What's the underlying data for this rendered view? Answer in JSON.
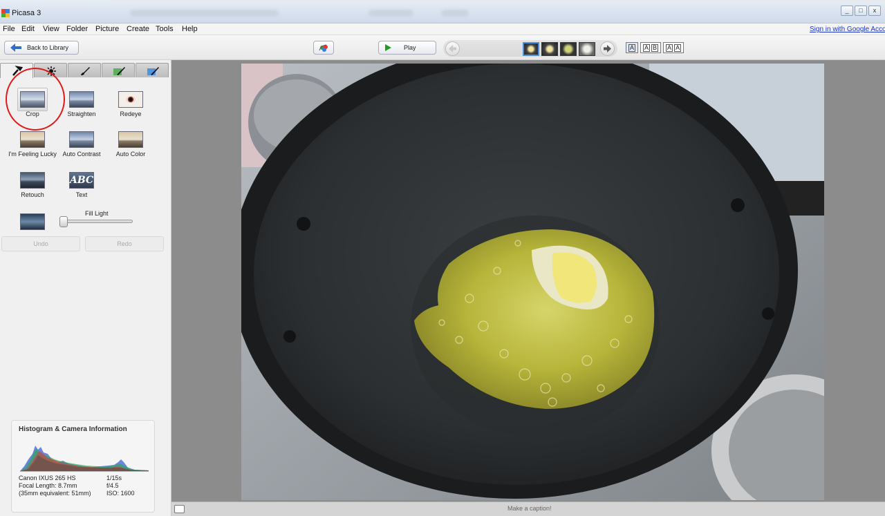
{
  "window": {
    "title": "Picasa 3",
    "min": "_",
    "max": "□",
    "close": "x"
  },
  "menu": [
    "File",
    "Edit",
    "View",
    "Folder",
    "Picture",
    "Create",
    "Tools",
    "Help"
  ],
  "signin": "Sign in with Google Accou",
  "toolbar": {
    "back_label": "Back to Library",
    "play_label": "Play",
    "caption_modes": [
      [
        "A"
      ],
      [
        "A",
        "B"
      ],
      [
        "A",
        "A"
      ]
    ]
  },
  "tools": {
    "crop": "Crop",
    "straighten": "Straighten",
    "redeye": "Redeye",
    "lucky": "I'm Feeling Lucky",
    "auto_contrast": "Auto Contrast",
    "auto_color": "Auto Color",
    "retouch": "Retouch",
    "text": "Text",
    "text_icon": "ABC",
    "fill_light": "Fill Light",
    "fill_light_level": 0,
    "undo": "Undo",
    "redo": "Redo"
  },
  "histogram": {
    "title": "Histogram & Camera Information",
    "camera": "Canon IXUS 265 HS",
    "focal": "Focal Length: 8.7mm",
    "equiv": "(35mm equivalent:  51mm)",
    "shutter": "1/15s",
    "aperture": "f/4.5",
    "iso": "ISO: 1600"
  },
  "caption": {
    "placeholder": "Make a caption!"
  },
  "colors": {
    "accent": "#4a8fdc",
    "annotation": "#e01818",
    "link": "#1a35c4"
  }
}
